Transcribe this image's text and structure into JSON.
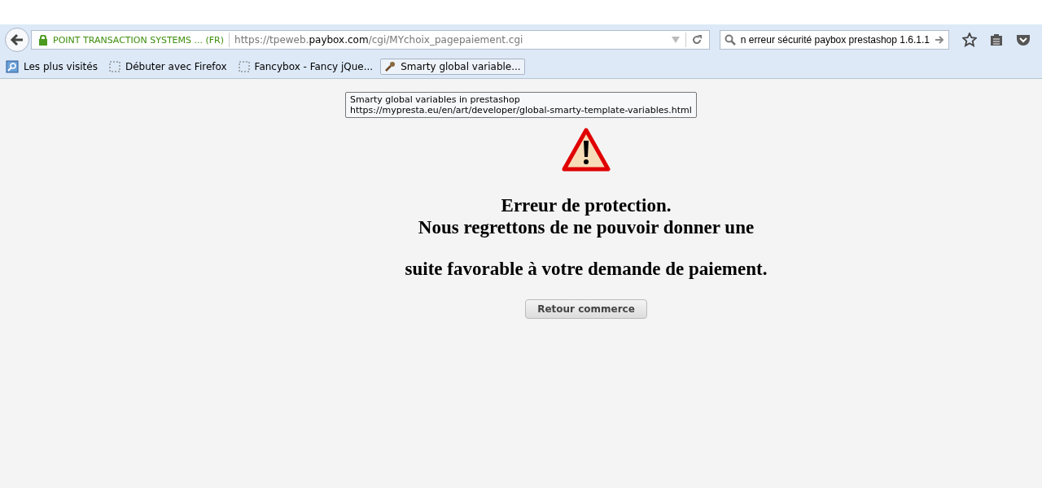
{
  "toolbar": {
    "identity": "POINT TRANSACTION SYSTEMS ... (FR)",
    "url": [
      {
        "text": "https://tpeweb.",
        "highlighted": false
      },
      {
        "text": "paybox.com",
        "highlighted": true
      },
      {
        "text": "/cgi/MYchoix_pagepaiement.cgi",
        "highlighted": false
      }
    ],
    "search": {
      "value": "n erreur sécurité paybox prestashop 1.6.1.1"
    }
  },
  "bookmarks": [
    {
      "label": "Les plus visités",
      "kind": "history",
      "hovered": false
    },
    {
      "label": "Débuter avec Firefox",
      "kind": "page",
      "hovered": false
    },
    {
      "label": "Fancybox - Fancy jQue...",
      "kind": "page",
      "hovered": false
    },
    {
      "label": "Smarty global variable...",
      "kind": "tool",
      "hovered": true
    }
  ],
  "tooltip": {
    "title": "Smarty global variables in prestashop",
    "url": "https://mypresta.eu/en/art/developer/global-smarty-template-variables.html"
  },
  "page": {
    "heading": [
      "Erreur de protection.",
      "Nous regrettons de ne pouvoir donner une"
    ],
    "heading_continued": "suite favorable à votre demande de paiement.",
    "button": "Retour commerce"
  }
}
